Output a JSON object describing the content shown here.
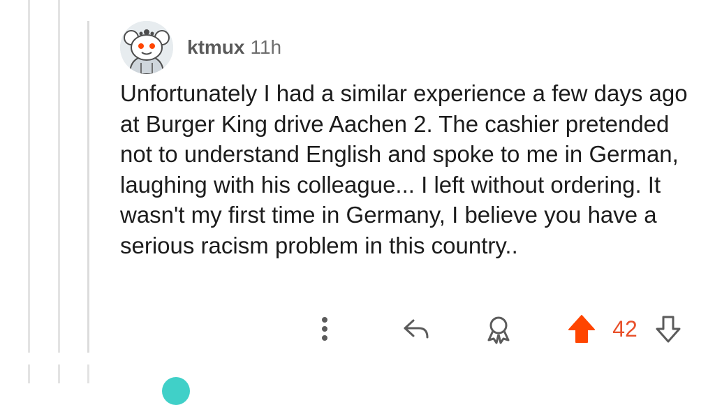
{
  "comment": {
    "username": "ktmux",
    "timestamp": "11h",
    "body": "Unfortunately I had a similar experience a few days ago  at Burger King drive Aachen 2. The cashier pretended not to understand English and spoke to me in German, laughing with his colleague... I left without ordering. It wasn't my first time in Germany, I believe you have a serious racism problem in this country..",
    "score": "42",
    "upvoted": true
  },
  "icons": {
    "more": "more-vertical-icon",
    "reply": "reply-arrow-icon",
    "award": "award-icon",
    "upvote": "upvote-arrow-icon",
    "downvote": "downvote-arrow-icon"
  },
  "colors": {
    "upvote_active": "#ff4500",
    "score": "#e8502a",
    "thread_line": "#e3e3e3",
    "text": "#1c1c1c",
    "meta": "#6e6e6e"
  }
}
